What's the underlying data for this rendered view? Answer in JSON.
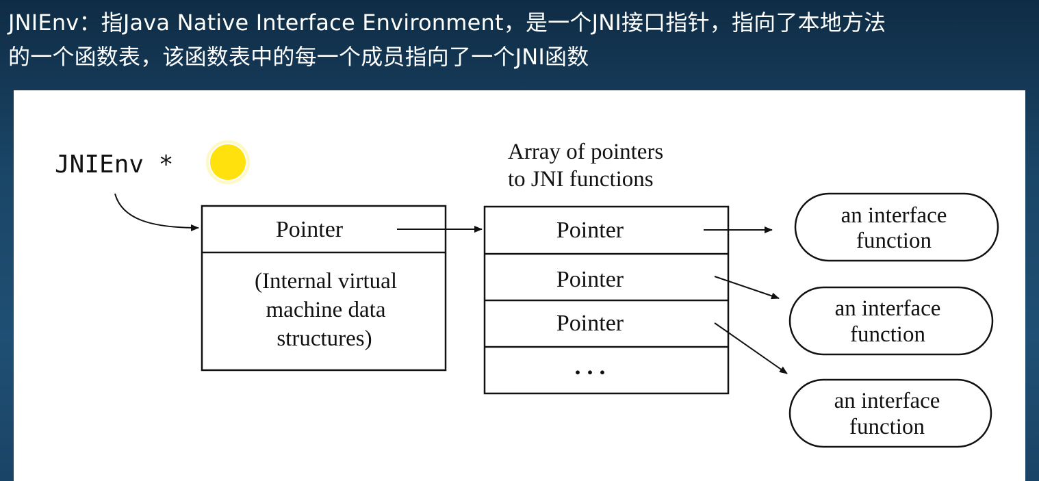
{
  "slide": {
    "heading_line1": "JNIEnv：指Java Native Interface Environment，是一个JNI接口指针，指向了本地方法",
    "heading_line2": "的一个函数表，该函数表中的每一个成员指向了一个JNI函数"
  },
  "diagram": {
    "env_label": "JNIEnv *",
    "array_caption_line1": "Array of pointers",
    "array_caption_line2": "to JNI functions",
    "env_block": {
      "pointer_label": "Pointer",
      "internal_line1": "(Internal virtual",
      "internal_line2": "machine data",
      "internal_line3": "structures)"
    },
    "function_table": {
      "rows": [
        "Pointer",
        "Pointer",
        "Pointer"
      ],
      "ellipsis": ". . ."
    },
    "functions": [
      {
        "line1": "an interface",
        "line2": "function"
      },
      {
        "line1": "an interface",
        "line2": "function"
      },
      {
        "line1": "an interface",
        "line2": "function"
      }
    ],
    "colors": {
      "stroke": "#111111",
      "highlight": "#ffe000"
    }
  }
}
